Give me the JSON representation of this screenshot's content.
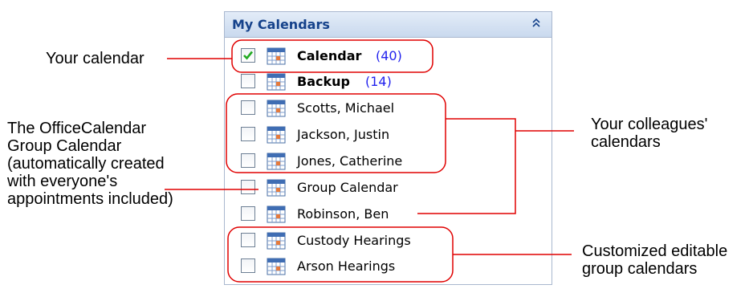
{
  "pane": {
    "title": "My Calendars",
    "collapse_icon": "double-chevron-up-icon",
    "items": [
      {
        "label": "Calendar",
        "count": "(40)",
        "checked": true,
        "bold": true
      },
      {
        "label": "Backup",
        "count": "(14)",
        "checked": false,
        "bold": true
      },
      {
        "label": "Scotts, Michael",
        "count": "",
        "checked": false,
        "bold": false
      },
      {
        "label": "Jackson, Justin",
        "count": "",
        "checked": false,
        "bold": false
      },
      {
        "label": "Jones, Catherine",
        "count": "",
        "checked": false,
        "bold": false
      },
      {
        "label": "Group Calendar",
        "count": "",
        "checked": false,
        "bold": false
      },
      {
        "label": "Robinson, Ben",
        "count": "",
        "checked": false,
        "bold": false
      },
      {
        "label": "Custody Hearings",
        "count": "",
        "checked": false,
        "bold": false
      },
      {
        "label": "Arson Hearings",
        "count": "",
        "checked": false,
        "bold": false
      }
    ]
  },
  "annotations": {
    "your_calendar": "Your calendar",
    "group_calendar": [
      "The OfficeCalendar",
      "Group Calendar",
      "(automatically created",
      "with everyone's",
      "appointments included)"
    ],
    "colleagues": [
      "Your colleagues'",
      "calendars"
    ],
    "customized": [
      "Customized editable",
      "group calendars"
    ]
  },
  "colors": {
    "header_text": "#15428b",
    "count_text": "#2222ee",
    "annotation_line": "#e00000",
    "checkmark": "#22aa22"
  }
}
